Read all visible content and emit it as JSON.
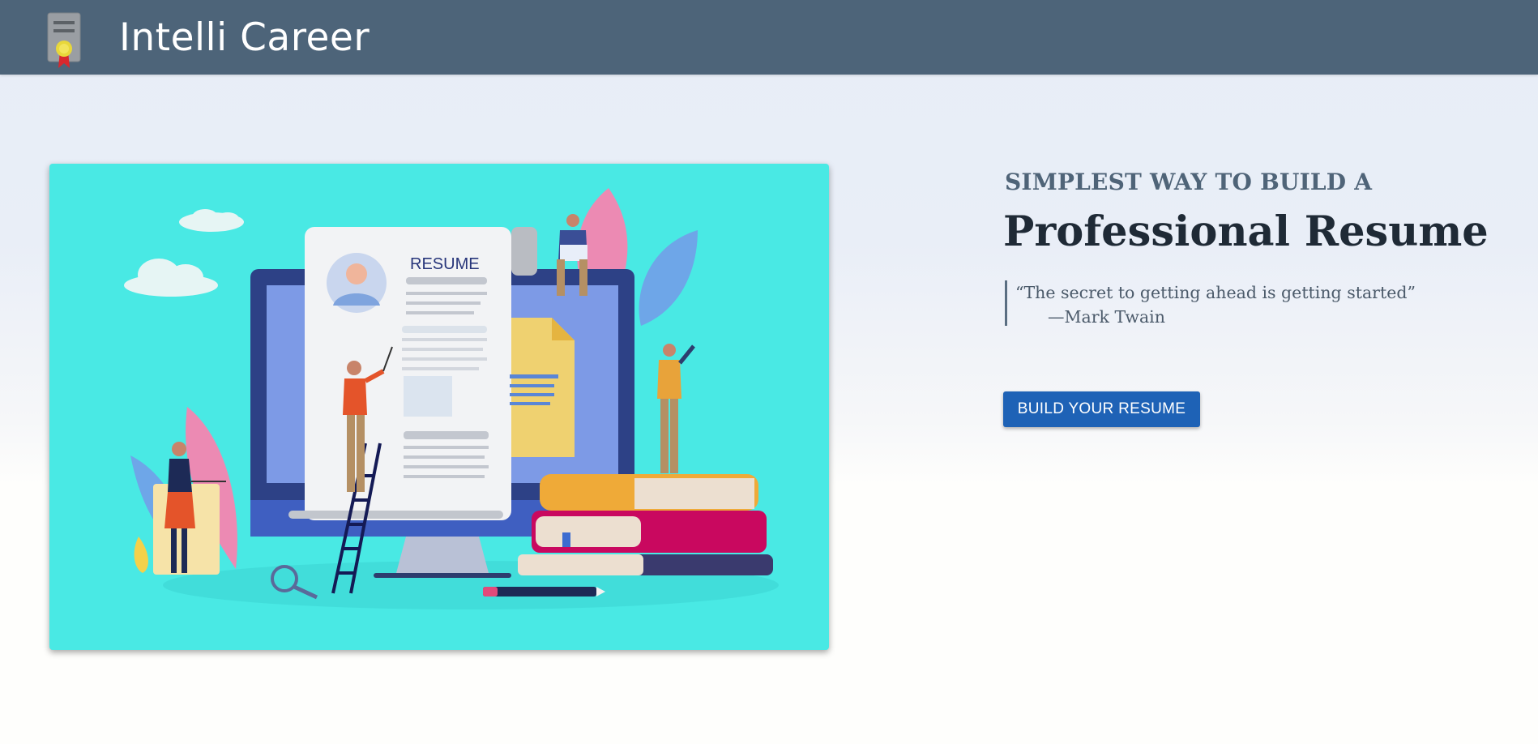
{
  "header": {
    "brand": "Intelli Career",
    "logo_icon": "certificate-icon"
  },
  "hero": {
    "illustration": {
      "icon": "resume-illustration",
      "label": "RESUME"
    },
    "tagline": "SIMPLEST WAY TO BUILD A",
    "headline": "Professional Resume",
    "quote": {
      "text": "“The secret to getting ahead is getting started”",
      "author": "—Mark Twain"
    },
    "cta_label": "BUILD YOUR RESUME"
  },
  "colors": {
    "header_bg": "#4d6479",
    "hero_bg": "#49e9e4",
    "cta_bg": "#1e62b6",
    "headline": "#1f2a36"
  }
}
